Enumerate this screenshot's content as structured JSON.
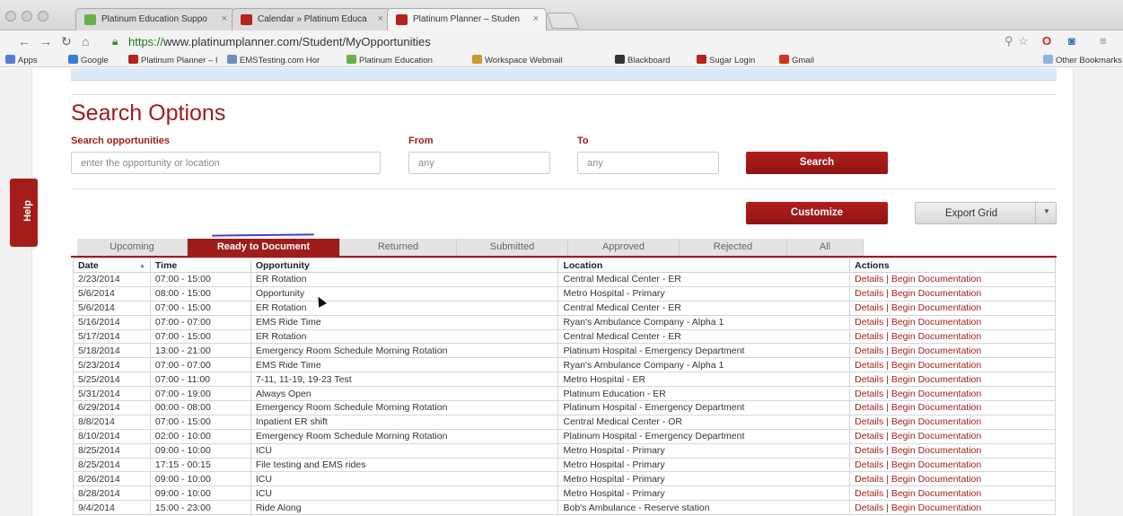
{
  "browser": {
    "tabs": [
      {
        "title": "Platinum Education Suppo",
        "active": false
      },
      {
        "title": "Calendar » Platinum Educa",
        "active": false
      },
      {
        "title": "Platinum Planner – Studen",
        "active": true
      }
    ],
    "close_glyph": "×",
    "url_scheme": "https://",
    "url_rest": "www.platinumplanner.com/Student/MyOpportunities",
    "bookmarks": [
      {
        "label": "Apps",
        "color": "#5b7bd5"
      },
      {
        "label": "Google",
        "color": "#3a7bd5"
      },
      {
        "label": "Platinum Planner – I",
        "color": "#b3231f"
      },
      {
        "label": "EMSTesting.com Hor",
        "color": "#6f8fb8"
      },
      {
        "label": "Platinum Education",
        "color": "#6ab04c"
      },
      {
        "label": "Workspace Webmail",
        "color": "#c79a2f"
      },
      {
        "label": "Blackboard",
        "color": "#333333"
      },
      {
        "label": "Sugar Login",
        "color": "#b3231f"
      },
      {
        "label": "Gmail",
        "color": "#d93025"
      }
    ],
    "other_bookmarks": "Other Bookmarks"
  },
  "help_label": "Help",
  "search": {
    "title": "Search Options",
    "opportunities_label": "Search opportunities",
    "opportunities_placeholder": "enter the opportunity or location",
    "from_label": "From",
    "from_placeholder": "any",
    "to_label": "To",
    "to_placeholder": "any",
    "search_button": "Search"
  },
  "customize_button": "Customize",
  "export_button": "Export Grid",
  "grid_tabs": [
    "Upcoming",
    "Ready to Document",
    "Returned",
    "Submitted",
    "Approved",
    "Rejected",
    "All"
  ],
  "active_grid_tab": "Ready to Document",
  "columns": [
    "Date",
    "Time",
    "Opportunity",
    "Location",
    "Actions"
  ],
  "rows": [
    {
      "date": "2/23/2014",
      "time": "07:00 - 15:00",
      "opportunity": "ER Rotation",
      "location": "Central Medical Center - ER",
      "actions": "Details | Begin Documentation"
    },
    {
      "date": "5/6/2014",
      "time": "08:00 - 15:00",
      "opportunity": "Opportunity",
      "location": "Metro Hospital - Primary",
      "actions": "Details | Begin Documentation"
    },
    {
      "date": "5/6/2014",
      "time": "07:00 - 15:00",
      "opportunity": "ER Rotation",
      "location": "Central Medical Center - ER",
      "actions": "Details | Begin Documentation"
    },
    {
      "date": "5/16/2014",
      "time": "07:00 - 07:00",
      "opportunity": "EMS Ride Time",
      "location": "Ryan's Ambulance Company - Alpha 1",
      "actions": "Details | Begin Documentation"
    },
    {
      "date": "5/17/2014",
      "time": "07:00 - 15:00",
      "opportunity": "ER Rotation",
      "location": "Central Medical Center - ER",
      "actions": "Details | Begin Documentation"
    },
    {
      "date": "5/18/2014",
      "time": "13:00 - 21:00",
      "opportunity": "Emergency Room Schedule Morning Rotation",
      "location": "Platinum Hospital - Emergency Department",
      "actions": "Details | Begin Documentation"
    },
    {
      "date": "5/23/2014",
      "time": "07:00 - 07:00",
      "opportunity": "EMS Ride Time",
      "location": "Ryan's Ambulance Company - Alpha 1",
      "actions": "Details | Begin Documentation"
    },
    {
      "date": "5/25/2014",
      "time": "07:00 - 11:00",
      "opportunity": "7-11, 11-19, 19-23 Test",
      "location": "Metro Hospital - ER",
      "actions": "Details | Begin Documentation"
    },
    {
      "date": "5/31/2014",
      "time": "07:00 - 19:00",
      "opportunity": "Always Open",
      "location": "Platinum Education - ER",
      "actions": "Details | Begin Documentation"
    },
    {
      "date": "6/29/2014",
      "time": "00:00 - 08:00",
      "opportunity": "Emergency Room Schedule Morning Rotation",
      "location": "Platinum Hospital - Emergency Department",
      "actions": "Details | Begin Documentation"
    },
    {
      "date": "8/8/2014",
      "time": "07:00 - 15:00",
      "opportunity": "Inpatient ER shift",
      "location": "Central Medical Center - OR",
      "actions": "Details | Begin Documentation"
    },
    {
      "date": "8/10/2014",
      "time": "02:00 - 10:00",
      "opportunity": "Emergency Room Schedule Morning Rotation",
      "location": "Platinum Hospital - Emergency Department",
      "actions": "Details | Begin Documentation"
    },
    {
      "date": "8/25/2014",
      "time": "09:00 - 10:00",
      "opportunity": "ICU",
      "location": "Metro Hospital - Primary",
      "actions": "Details | Begin Documentation"
    },
    {
      "date": "8/25/2014",
      "time": "17:15 - 00:15",
      "opportunity": "File testing and EMS rides",
      "location": "Metro Hospital - Primary",
      "actions": "Details | Begin Documentation"
    },
    {
      "date": "8/26/2014",
      "time": "09:00 - 10:00",
      "opportunity": "ICU",
      "location": "Metro Hospital - Primary",
      "actions": "Details | Begin Documentation"
    },
    {
      "date": "8/28/2014",
      "time": "09:00 - 10:00",
      "opportunity": "ICU",
      "location": "Metro Hospital - Primary",
      "actions": "Details | Begin Documentation"
    },
    {
      "date": "9/4/2014",
      "time": "15:00 - 23:00",
      "opportunity": "Ride Along",
      "location": "Bob's Ambulance - Reserve station",
      "actions": "Details | Begin Documentation"
    }
  ],
  "colors": {
    "accent": "#9e1c1a",
    "info_bar": "#dceaf6",
    "pen_annotation": "#3b46c8"
  },
  "icons": [
    "back-arrow-icon",
    "forward-arrow-icon",
    "reload-icon",
    "home-icon",
    "lock-icon",
    "zoom-icon",
    "star-icon",
    "opera-icon",
    "extension-icon",
    "menu-icon",
    "folder-icon",
    "sort-icon",
    "dropdown-caret-icon",
    "mouse-cursor-icon"
  ]
}
